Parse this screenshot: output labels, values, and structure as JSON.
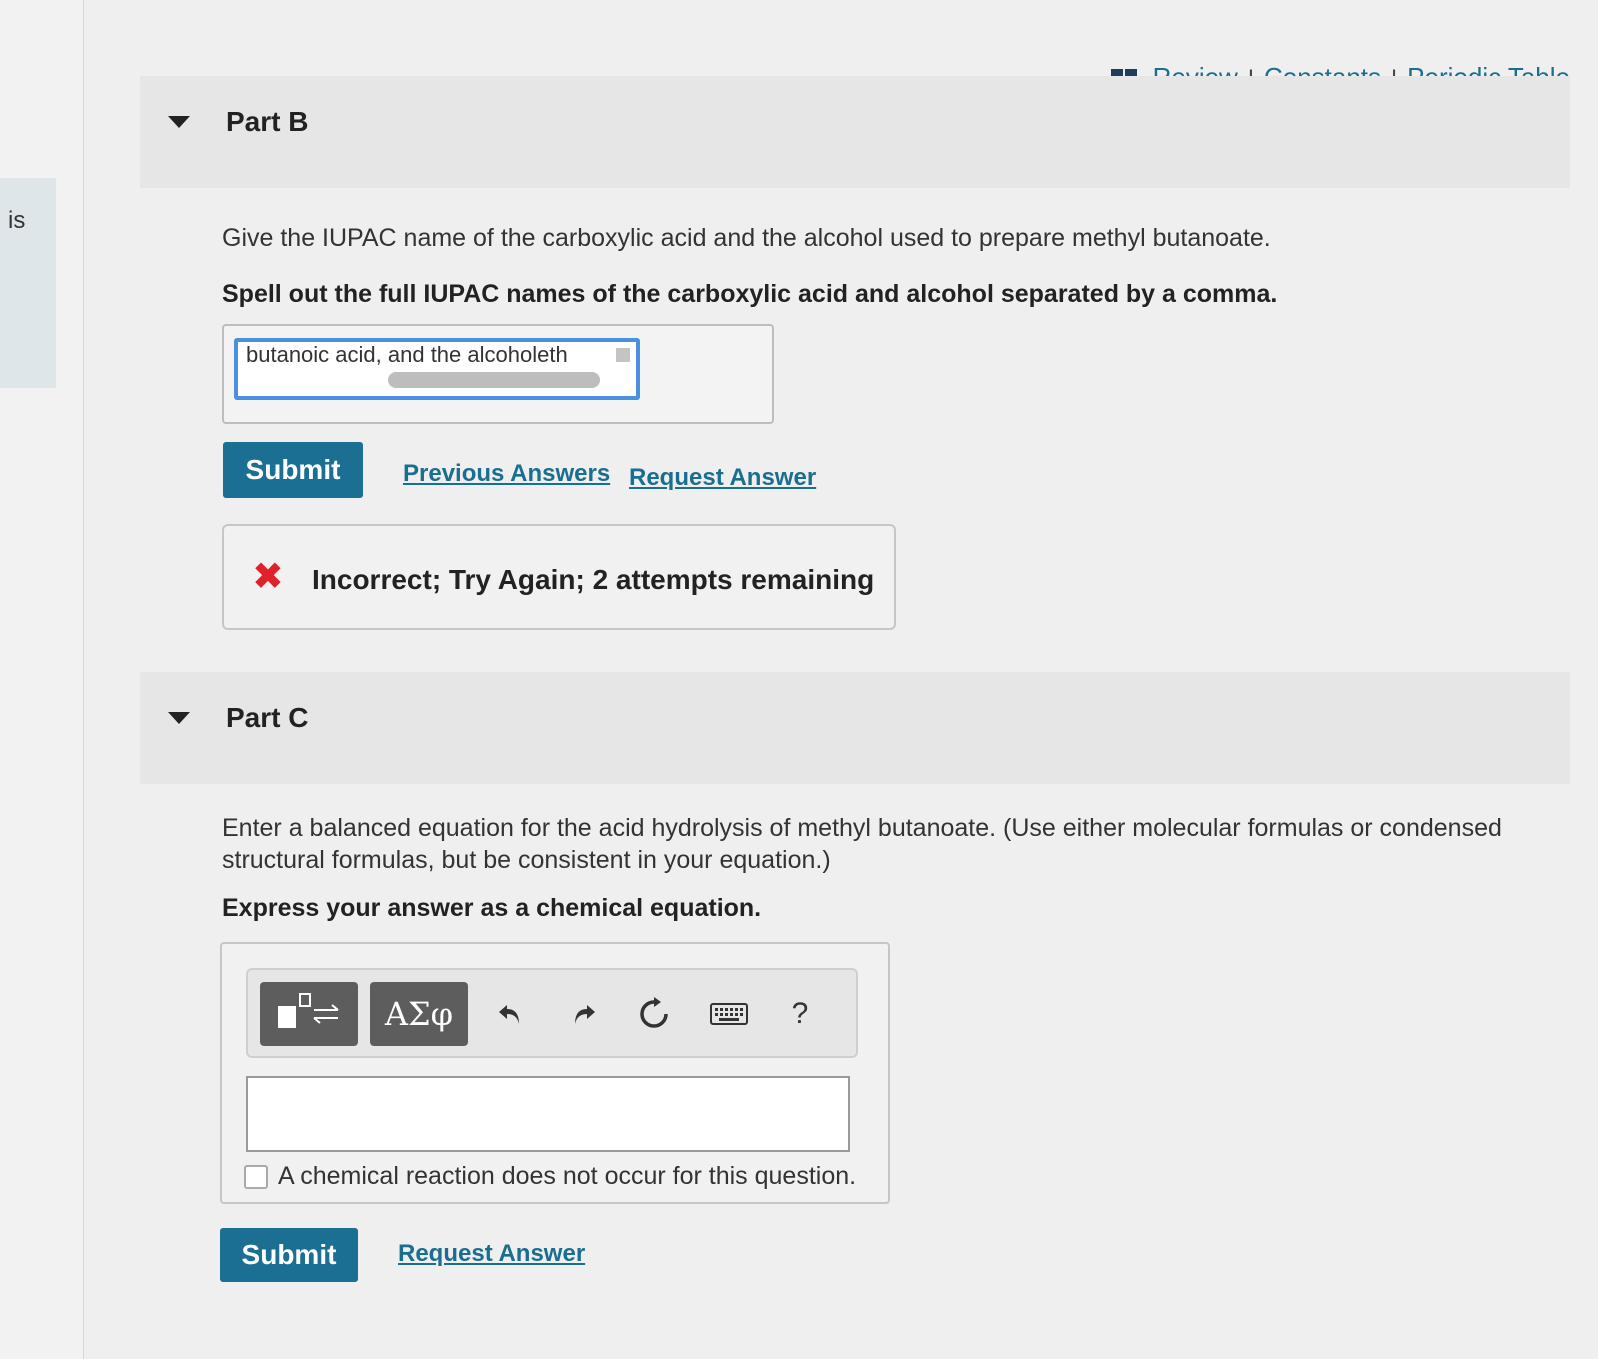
{
  "left_tab": {
    "text": "is"
  },
  "top_links": {
    "review": "Review",
    "separator": "I",
    "constants": "Constants",
    "periodic_table": "Periodic Table"
  },
  "part_b": {
    "title": "Part B",
    "question": "Give the IUPAC name of the carboxylic acid and the alcohol used to prepare methyl butanoate.",
    "instruction": "Spell out the full IUPAC names of the carboxylic acid and alcohol separated by a comma.",
    "answer_value": "butanoic acid, and the alcoholeth",
    "submit_label": "Submit",
    "previous_answers_label": "Previous Answers",
    "request_answer_label": "Request Answer",
    "feedback": "Incorrect; Try Again; 2 attempts remaining"
  },
  "part_c": {
    "title": "Part C",
    "question": "Enter a balanced equation for the acid hydrolysis of methyl butanoate. (Use either molecular formulas or condensed structural formulas, but be consistent in your equation.)",
    "instruction": "Express your answer as a chemical equation.",
    "toolbar": {
      "templates_icon": "templates-icon",
      "symbols_label": "ΑΣφ",
      "help_label": "?"
    },
    "no_reaction_label": "A chemical reaction does not occur for this question.",
    "submit_label": "Submit",
    "request_answer_label": "Request Answer"
  },
  "colors": {
    "accent": "#1b6f93",
    "link": "#1a6e8f",
    "error": "#e0202a",
    "input_focus": "#4a8fe0"
  }
}
